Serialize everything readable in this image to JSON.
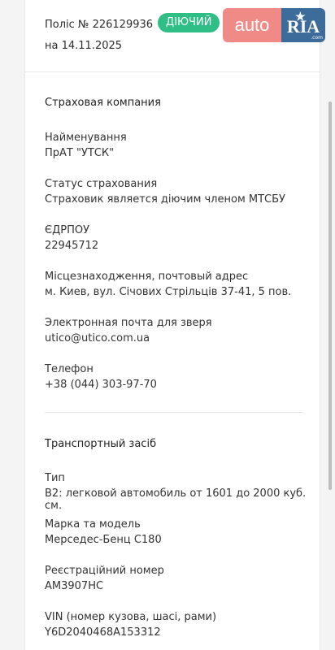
{
  "policy": {
    "number_text": "Поліс № 226129936",
    "status_badge": "ДІЮЧИЙ",
    "date_text": "на 14.11.2025"
  },
  "logo": {
    "auto": "auto",
    "ria": "RIA",
    "com": ".com"
  },
  "insurer": {
    "section_title": "Страховая компания",
    "fields": [
      {
        "label": "Найменування",
        "value": "ПрАТ \"УТСК\""
      },
      {
        "label": "Статус страхования",
        "value": "Страховик является діючим членом МТСБУ"
      },
      {
        "label": "ЄДРПОУ",
        "value": "22945712"
      },
      {
        "label": "Місцезнаходження, почтовый адрес",
        "value": "м. Киев, вул. Січових Стрільців 37-41, 5 пов."
      },
      {
        "label": "Электронная почта для зверя",
        "value": "utico@utico.com.ua"
      },
      {
        "label": "Телефон",
        "value": "+38 (044) 303-97-70"
      }
    ]
  },
  "vehicle": {
    "section_title": "Транспортный засіб",
    "fields": [
      {
        "label": "Тип",
        "value": "B2: легковой автомобиль от 1601 до 2000 куб. см."
      },
      {
        "label": "Марка та модель",
        "value": "Мерседес-Бенц C180"
      },
      {
        "label": "Реєстраційний номер",
        "value": "AM3907HC"
      },
      {
        "label": "VIN (номер кузова, шасі, рами)",
        "value": "Y6D2040468A153312"
      }
    ]
  },
  "colors": {
    "badge_green": "#2fbf86",
    "logo_auto": "#f08a86",
    "logo_ria": "#3d6c9b"
  }
}
